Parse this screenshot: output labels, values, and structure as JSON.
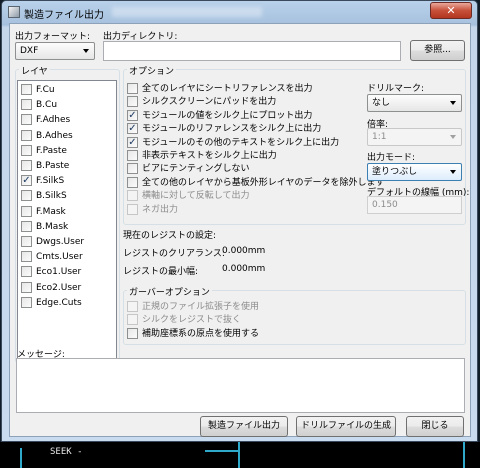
{
  "window": {
    "title": "製造ファイル出力",
    "close_glyph": "✕"
  },
  "background": {
    "status_text": "SEEK -"
  },
  "format": {
    "label": "出力フォーマット:",
    "value": "DXF"
  },
  "directory": {
    "label": "出力ディレクトリ:",
    "value": "",
    "browse_label": "参照..."
  },
  "layers": {
    "title": "レイヤ",
    "items": [
      {
        "name": "F.Cu",
        "checked": false
      },
      {
        "name": "B.Cu",
        "checked": false
      },
      {
        "name": "F.Adhes",
        "checked": false
      },
      {
        "name": "B.Adhes",
        "checked": false
      },
      {
        "name": "F.Paste",
        "checked": false
      },
      {
        "name": "B.Paste",
        "checked": false
      },
      {
        "name": "F.SilkS",
        "checked": true
      },
      {
        "name": "B.SilkS",
        "checked": false
      },
      {
        "name": "F.Mask",
        "checked": false
      },
      {
        "name": "B.Mask",
        "checked": false
      },
      {
        "name": "Dwgs.User",
        "checked": false
      },
      {
        "name": "Cmts.User",
        "checked": false
      },
      {
        "name": "Eco1.User",
        "checked": false
      },
      {
        "name": "Eco2.User",
        "checked": false
      },
      {
        "name": "Edge.Cuts",
        "checked": false
      }
    ]
  },
  "options": {
    "title": "オプション",
    "items": [
      {
        "label": "全てのレイヤにシートリファレンスを出力",
        "checked": false,
        "enabled": true
      },
      {
        "label": "シルクスクリーンにパッドを出力",
        "checked": false,
        "enabled": true
      },
      {
        "label": "モジュールの値をシルク上にプロット出力",
        "checked": true,
        "enabled": true
      },
      {
        "label": "モジュールのリファレンスをシルク上に出力",
        "checked": true,
        "enabled": true
      },
      {
        "label": "モジュールのその他のテキストをシルク上に出力",
        "checked": true,
        "enabled": true
      },
      {
        "label": "非表示テキストをシルク上に出力",
        "checked": false,
        "enabled": true
      },
      {
        "label": "ビアにテンティングしない",
        "checked": false,
        "enabled": true
      },
      {
        "label": "全ての他のレイヤから基板外形レイヤのデータを除外します",
        "checked": false,
        "enabled": true
      },
      {
        "label": "横軸に対して反転して出力",
        "checked": false,
        "enabled": false
      },
      {
        "label": "ネガ出力",
        "checked": false,
        "enabled": false
      }
    ],
    "drill_mark": {
      "label": "ドリルマーク:",
      "value": "なし"
    },
    "scale": {
      "label": "倍率:",
      "value": "1:1"
    },
    "output_mode": {
      "label": "出力モード:",
      "value": "塗りつぶし"
    },
    "default_line_width": {
      "label": "デフォルトの線幅 (mm):",
      "value": "0.150"
    }
  },
  "resist": {
    "title": "現在のレジストの設定:",
    "clearance": {
      "label": "レジストのクリアランス:",
      "value": "0.000mm"
    },
    "min_width": {
      "label": "レジストの最小幅:",
      "value": "0.000mm"
    }
  },
  "gerber": {
    "title": "ガーバーオプション",
    "items": [
      {
        "label": "正規のファイル拡張子を使用",
        "checked": false,
        "enabled": false
      },
      {
        "label": "シルクをレジストで抜く",
        "checked": false,
        "enabled": false
      },
      {
        "label": "補助座標系の原点を使用する",
        "checked": false,
        "enabled": true
      }
    ]
  },
  "messages": {
    "label": "メッセージ:"
  },
  "buttons": {
    "plot": "製造ファイル出力",
    "drill": "ドリルファイルの生成",
    "close": "閉じる"
  },
  "check_glyph": "✓"
}
